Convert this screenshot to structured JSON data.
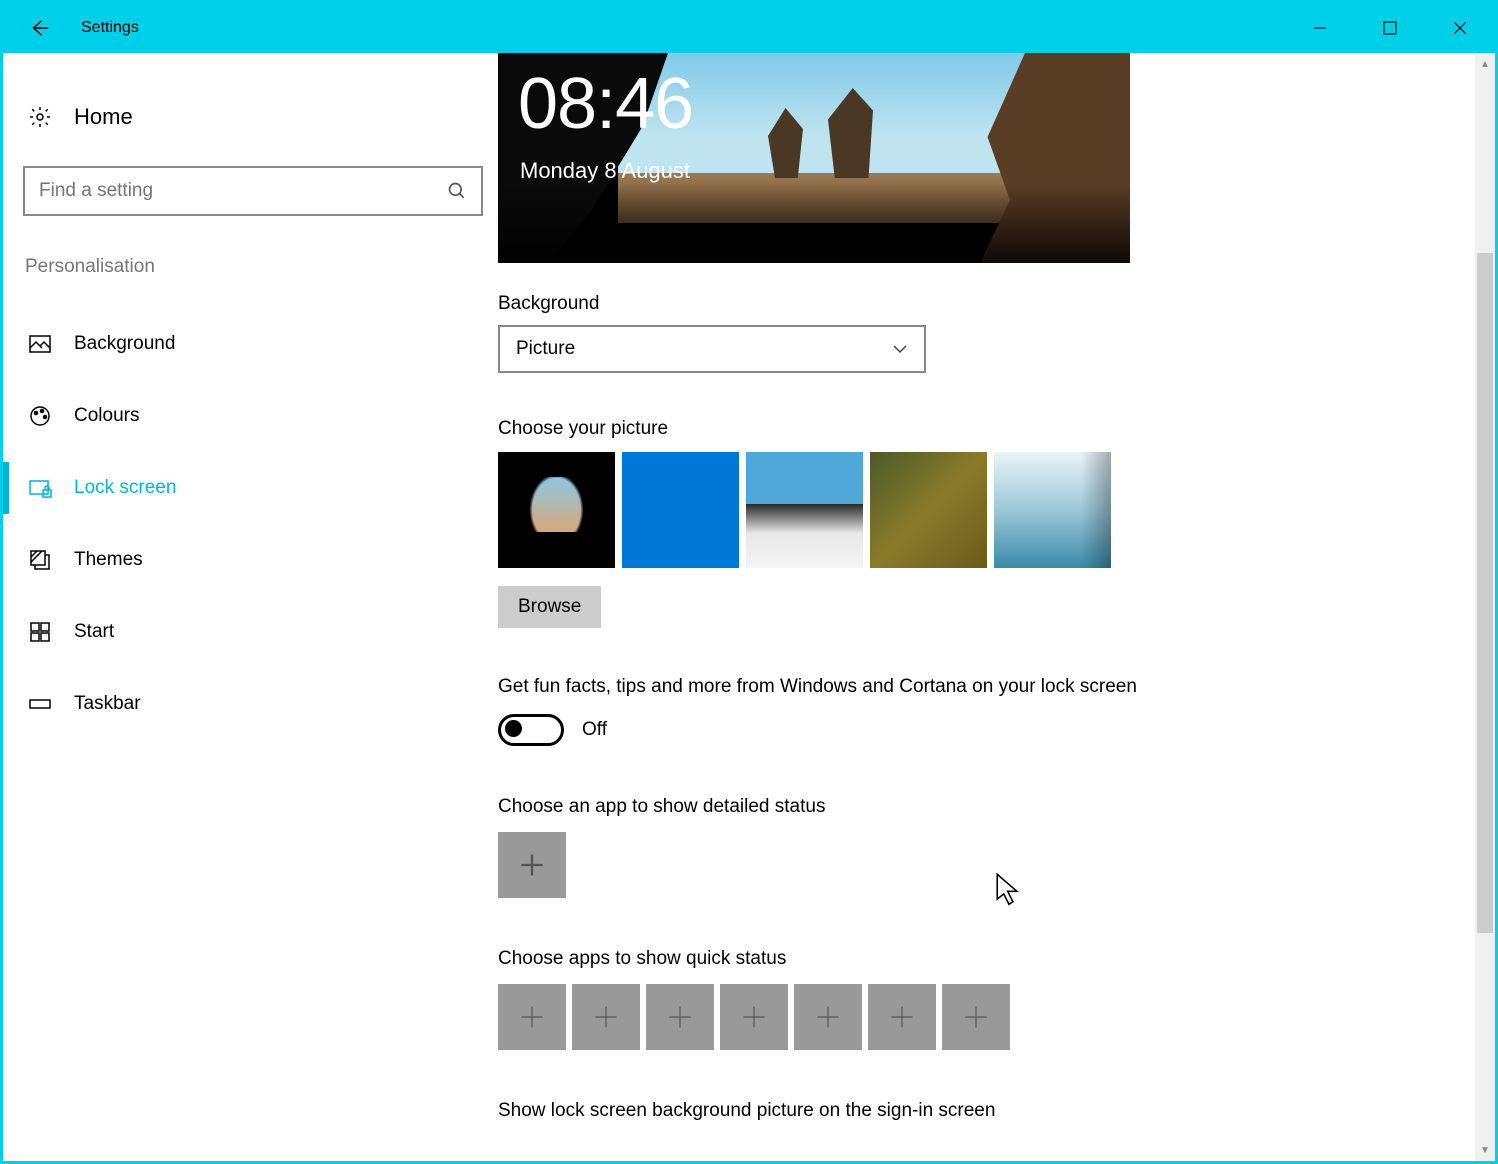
{
  "titlebar": {
    "title": "Settings"
  },
  "sidebar": {
    "home": "Home",
    "search_placeholder": "Find a setting",
    "section": "Personalisation",
    "items": [
      {
        "label": "Background"
      },
      {
        "label": "Colours"
      },
      {
        "label": "Lock screen"
      },
      {
        "label": "Themes"
      },
      {
        "label": "Start"
      },
      {
        "label": "Taskbar"
      }
    ]
  },
  "preview": {
    "time": "08:46",
    "date": "Monday 8 August"
  },
  "background_section": {
    "heading": "Background",
    "selected": "Picture"
  },
  "choose_picture": {
    "heading": "Choose your picture",
    "browse": "Browse"
  },
  "fun_facts": {
    "heading": "Get fun facts, tips and more from Windows and Cortana on your lock screen",
    "state": "Off"
  },
  "detailed_status": {
    "heading": "Choose an app to show detailed status"
  },
  "quick_status": {
    "heading": "Choose apps to show quick status",
    "slots": 7
  },
  "signin": {
    "heading": "Show lock screen background picture on the sign-in screen"
  }
}
